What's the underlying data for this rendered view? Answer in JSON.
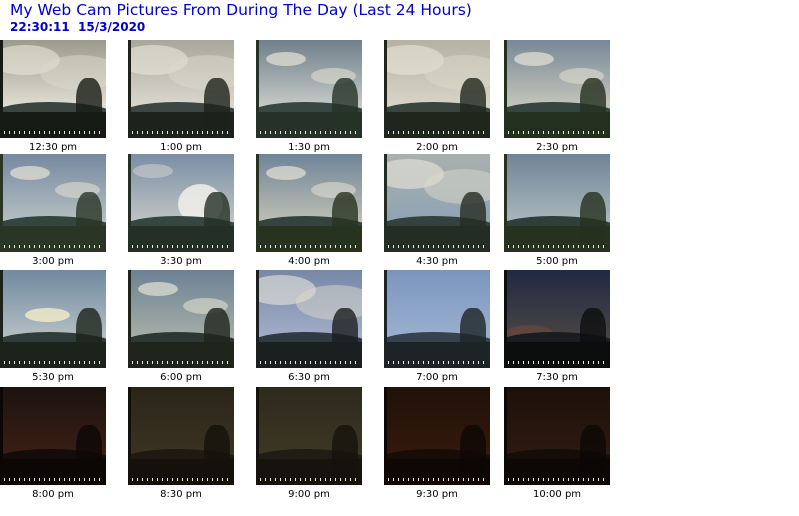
{
  "page": {
    "title": "My Web Cam Pictures From During The Day (Last 24 Hours)",
    "timestamp": "22:30:11  15/3/2020"
  },
  "colors": {
    "heading": "#0000cc"
  },
  "images": [
    {
      "time": "12:30 pm",
      "sky_top": "#9c9a8c",
      "sky_bottom": "#e2e0d6",
      "hill": "#3b4540",
      "ground": "#161a14",
      "cloudy": "heavy"
    },
    {
      "time": "1:00 pm",
      "sky_top": "#a9a79c",
      "sky_bottom": "#dcdad0",
      "hill": "#3c4642",
      "ground": "#1d221a",
      "cloudy": "heavy"
    },
    {
      "time": "1:30 pm",
      "sky_top": "#6f7f8c",
      "sky_bottom": "#c8cdc8",
      "hill": "#394742",
      "ground": "#263227",
      "cloudy": "light"
    },
    {
      "time": "2:00 pm",
      "sky_top": "#b5b2a4",
      "sky_bottom": "#d9d6c8",
      "hill": "#3a4540",
      "ground": "#1f271d",
      "cloudy": "heavy"
    },
    {
      "time": "2:30 pm",
      "sky_top": "#778897",
      "sky_bottom": "#c7c8bc",
      "hill": "#354640",
      "ground": "#24301f",
      "cloudy": "light"
    },
    {
      "time": "3:00 pm",
      "sky_top": "#7589a0",
      "sky_bottom": "#b7c0c2",
      "hill": "#34443f",
      "ground": "#2a3625",
      "cloudy": "light"
    },
    {
      "time": "3:30 pm",
      "sky_top": "#7a8ea6",
      "sky_bottom": "#c0c5c4",
      "hill": "#364640",
      "ground": "#243025",
      "cloudy": "puffy"
    },
    {
      "time": "4:00 pm",
      "sky_top": "#6f8498",
      "sky_bottom": "#bfc0b4",
      "hill": "#34433d",
      "ground": "#27331f",
      "cloudy": "light"
    },
    {
      "time": "4:30 pm",
      "sky_top": "#aab0ad",
      "sky_bottom": "#8fa3b4",
      "hill": "#33423e",
      "ground": "#242d23",
      "cloudy": "heavy"
    },
    {
      "time": "5:00 pm",
      "sky_top": "#6f8497",
      "sky_bottom": "#aab8bd",
      "hill": "#2f3f3a",
      "ground": "#26311f",
      "cloudy": "clear"
    },
    {
      "time": "5:30 pm",
      "sky_top": "#6f8aa1",
      "sky_bottom": "#b6c0c3",
      "hill": "#2f3c39",
      "ground": "#1b231a",
      "cloudy": "sunset"
    },
    {
      "time": "6:00 pm",
      "sky_top": "#6b8194",
      "sky_bottom": "#a7afa7",
      "hill": "#2d3733",
      "ground": "#1e241a",
      "cloudy": "light"
    },
    {
      "time": "6:30 pm",
      "sky_top": "#7687a8",
      "sky_bottom": "#a3aec8",
      "hill": "#2f3a42",
      "ground": "#1a1f1f",
      "cloudy": "heavy"
    },
    {
      "time": "7:00 pm",
      "sky_top": "#7a95bd",
      "sky_bottom": "#9bb0cf",
      "hill": "#36424d",
      "ground": "#1d2427",
      "cloudy": "clear"
    },
    {
      "time": "7:30 pm",
      "sky_top": "#1f2a44",
      "sky_bottom": "#4a4444",
      "hill": "#1a1c20",
      "ground": "#0c0e0e",
      "cloudy": "dusk"
    },
    {
      "time": "8:00 pm",
      "sky_top": "#1b1310",
      "sky_bottom": "#3a1e14",
      "hill": "#140c0a",
      "ground": "#0c0705",
      "cloudy": "night"
    },
    {
      "time": "8:30 pm",
      "sky_top": "#2a2418",
      "sky_bottom": "#3b3222",
      "hill": "#1e1a12",
      "ground": "#14110b",
      "cloudy": "night"
    },
    {
      "time": "9:00 pm",
      "sky_top": "#2d2a1c",
      "sky_bottom": "#3d3625",
      "hill": "#201d14",
      "ground": "#15130c",
      "cloudy": "night"
    },
    {
      "time": "9:30 pm",
      "sky_top": "#1f1108",
      "sky_bottom": "#34180c",
      "hill": "#170c06",
      "ground": "#0e0704",
      "cloudy": "night"
    },
    {
      "time": "10:00 pm",
      "sky_top": "#1c110a",
      "sky_bottom": "#2c1a10",
      "hill": "#150d08",
      "ground": "#0d0805",
      "cloudy": "night"
    }
  ]
}
